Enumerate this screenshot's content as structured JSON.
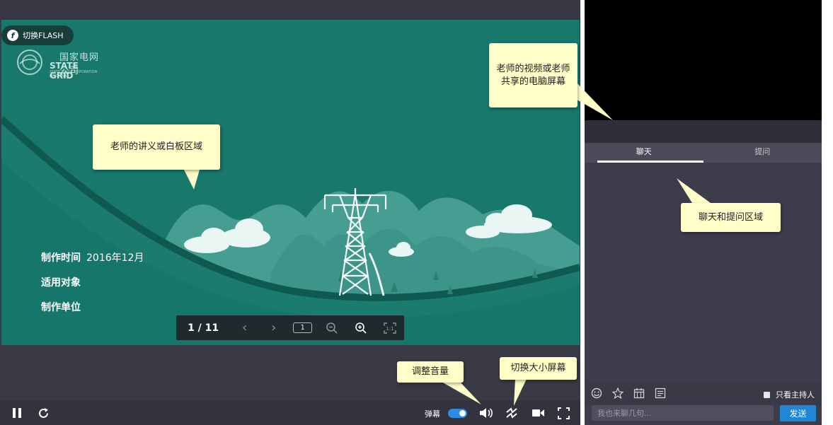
{
  "slide": {
    "flash_button": "切换FLASH",
    "logo_cn": "国家电网公司",
    "logo_en": "STATE GRID",
    "logo_sub": "STATE GRID CORPORATION OF CHINA",
    "meta": [
      {
        "label": "制作时间",
        "value": "2016年12月"
      },
      {
        "label": "适用对象",
        "value": ""
      },
      {
        "label": "制作单位",
        "value": ""
      }
    ]
  },
  "pager": {
    "page": "1 / 11",
    "page_box": "1",
    "icons": [
      "prev-page-icon",
      "next-page-icon",
      "zoom-out-icon",
      "zoom-in-icon",
      "fit-screen-icon"
    ]
  },
  "controls": {
    "danmu_label": "弹幕",
    "danmu_enabled": true,
    "icons": [
      "pause-icon",
      "refresh-icon",
      "volume-icon",
      "switch-screen-icon",
      "camera-icon",
      "fullscreen-icon"
    ]
  },
  "right": {
    "tabs": [
      "聊天",
      "提问"
    ],
    "active_tab": "聊天",
    "host_only_label": "只看主持人",
    "host_only_checked": false,
    "chat_placeholder": "我也来聊几句...",
    "send_label": "发送",
    "tool_icons": [
      "emoji-icon",
      "flower-icon",
      "calendar-icon",
      "notes-icon"
    ]
  },
  "callouts": {
    "video": "老师的视频或老师共享的电脑屏幕",
    "slides": "老师的讲义或白板区域",
    "chat": "聊天和提问区域",
    "volume": "调整音量",
    "screen": "切换大小屏幕"
  },
  "colors": {
    "slide_bg": "#17786b",
    "accent_blue": "#1f86d8",
    "callout_bg": "#fffdc8",
    "panel_bg": "#3c3c4a"
  }
}
